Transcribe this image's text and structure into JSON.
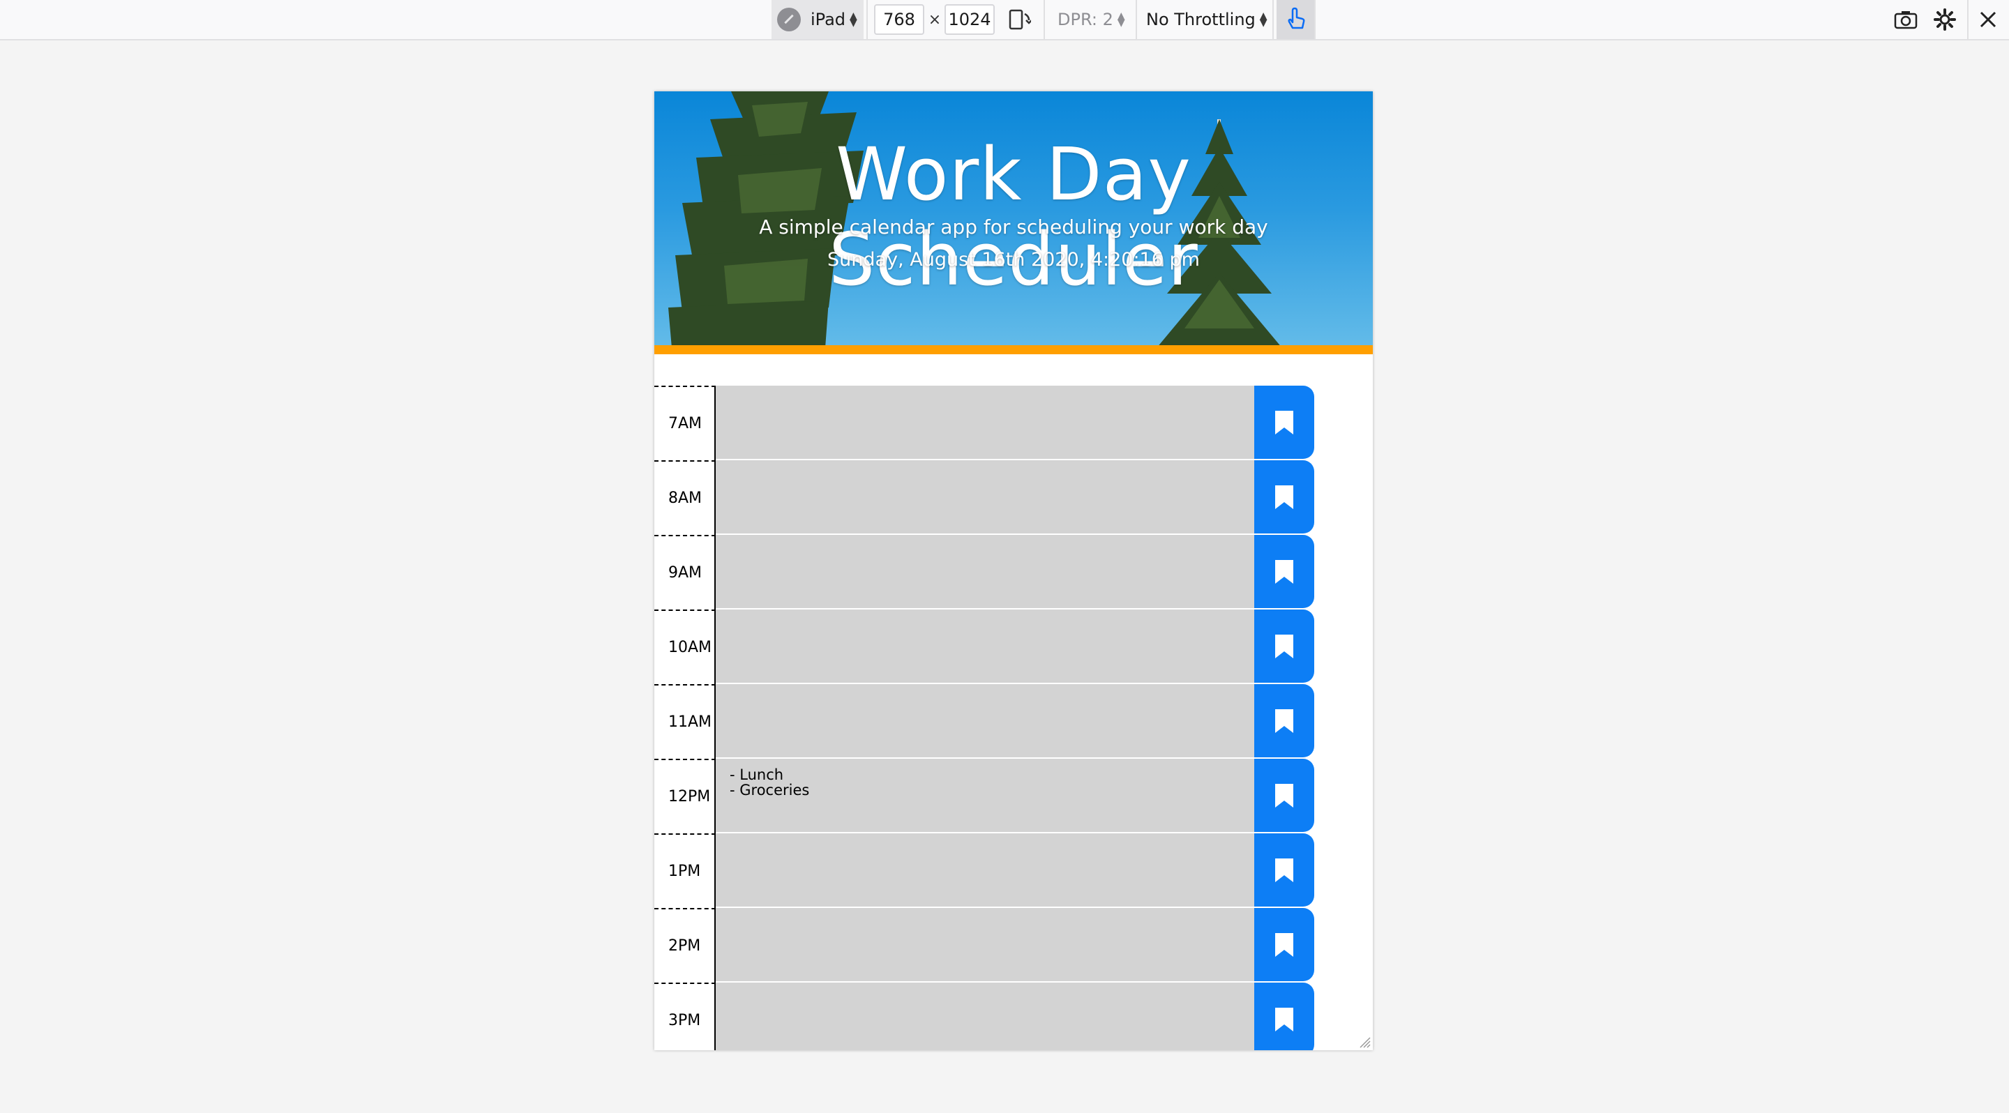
{
  "toolbar": {
    "device": "iPad",
    "width": "768",
    "times": "×",
    "height": "1024",
    "dpr": "DPR: 2",
    "throttling": "No Throttling"
  },
  "header": {
    "title": "Work Day Scheduler",
    "subtitle": "A simple calendar app for scheduling your work day",
    "date": "Sunday, August 16th 2020, 4:20:16 pm"
  },
  "colors": {
    "accent": "#0d7ef5",
    "header_stripe": "#ff9f00",
    "past_block": "#d3d3d3"
  },
  "schedule": {
    "rows": [
      {
        "hour": "7AM",
        "text": ""
      },
      {
        "hour": "8AM",
        "text": ""
      },
      {
        "hour": "9AM",
        "text": ""
      },
      {
        "hour": "10AM",
        "text": ""
      },
      {
        "hour": "11AM",
        "text": ""
      },
      {
        "hour": "12PM",
        "text": "- Lunch\n- Groceries"
      },
      {
        "hour": "1PM",
        "text": ""
      },
      {
        "hour": "2PM",
        "text": ""
      },
      {
        "hour": "3PM",
        "text": ""
      }
    ],
    "save_icon": "bookmark-icon"
  }
}
